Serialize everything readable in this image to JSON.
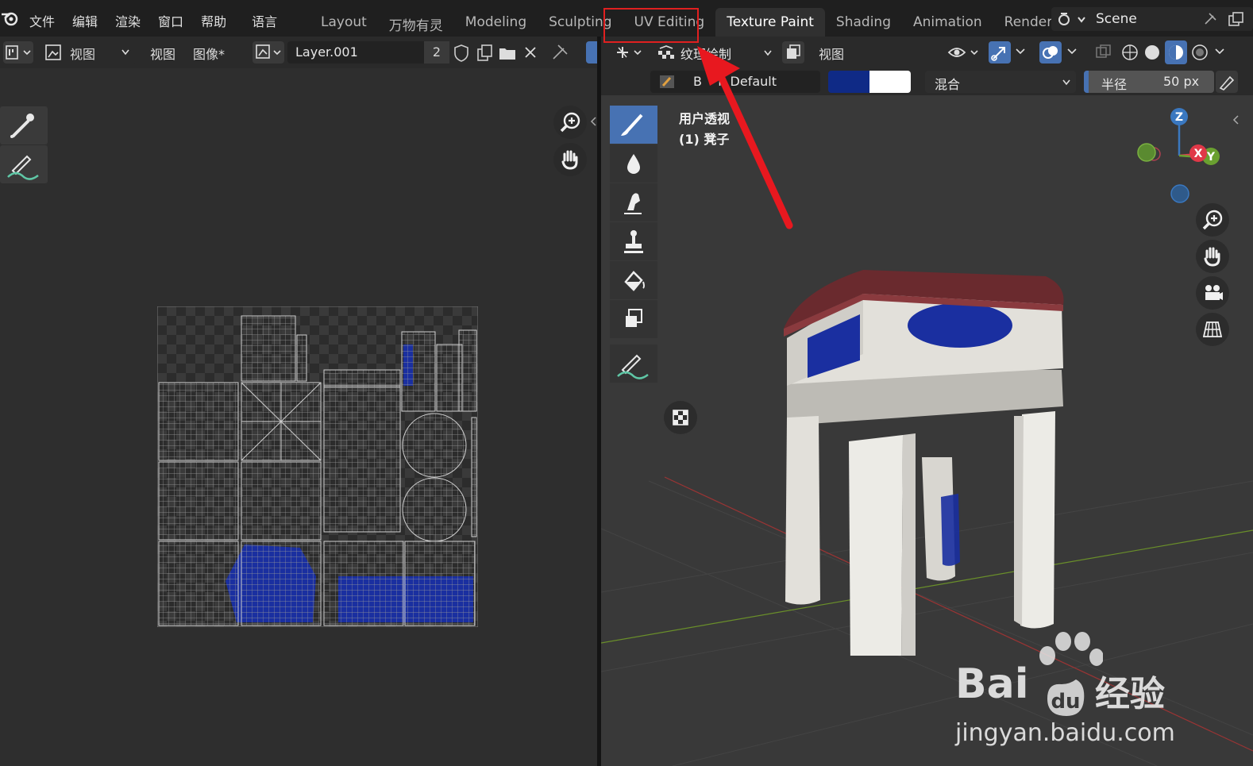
{
  "menu": [
    "文件",
    "编辑",
    "渲染",
    "窗口",
    "帮助",
    "语言"
  ],
  "workspace_tabs": [
    {
      "label": "Layout",
      "active": false
    },
    {
      "label": "万物有灵",
      "active": false
    },
    {
      "label": "Modeling",
      "active": false
    },
    {
      "label": "Sculpting",
      "active": false
    },
    {
      "label": "UV Editing",
      "active": false
    },
    {
      "label": "Texture Paint",
      "active": true
    },
    {
      "label": "Shading",
      "active": false
    },
    {
      "label": "Animation",
      "active": false
    },
    {
      "label": "Rendering",
      "active": false
    }
  ],
  "scene": {
    "label": "Scene"
  },
  "left_editor": {
    "view_menu": "视图",
    "view_label": "视图",
    "image_label": "图像*",
    "layer_name": "Layer.001",
    "layer_users": "2"
  },
  "right_editor": {
    "mode_label": "纹理绘制",
    "view_label": "视图",
    "brush_name": "B    n Default",
    "blend_label": "混合",
    "radius_label": "半径",
    "radius_value": "50 px",
    "viewport_name": "用户透视",
    "object_name": "(1) 凳子",
    "gizmo": {
      "z": "Z",
      "x": "X",
      "y": "Y"
    }
  },
  "colors": {
    "primary_color": "#0f2a86",
    "secondary_color": "#ffffff",
    "active_tool": "#4772b3",
    "highlight": "#e02020",
    "paint_blue": "#1a2fa0"
  },
  "watermark": {
    "brand": "Bai",
    "brand_suffix": "经验",
    "url": "jingyan.baidu.com"
  }
}
